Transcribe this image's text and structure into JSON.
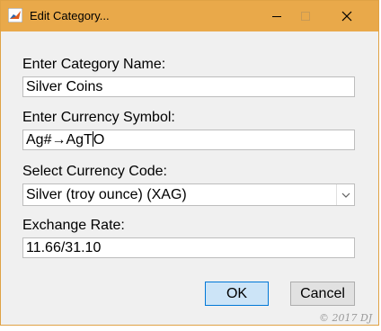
{
  "window": {
    "title": "Edit Category...",
    "app_icon": "matlab-icon",
    "controls": [
      "minimize-icon",
      "maximize-icon",
      "close-icon"
    ],
    "accent_color": "#e9a94a"
  },
  "form": {
    "name_label": "Enter Category Name:",
    "name_value": "Silver Coins",
    "symbol_label": "Enter Currency Symbol:",
    "symbol_value_before_caret": "Ag#→AgT",
    "symbol_value_after_caret": "O",
    "code_label": "Select Currency Code:",
    "code_selected": "Silver (troy ounce) (XAG)",
    "rate_label": "Exchange Rate:",
    "rate_value": "11.66/31.10"
  },
  "buttons": {
    "ok_label": "OK",
    "cancel_label": "Cancel"
  },
  "watermark": "© 2017 DJ"
}
